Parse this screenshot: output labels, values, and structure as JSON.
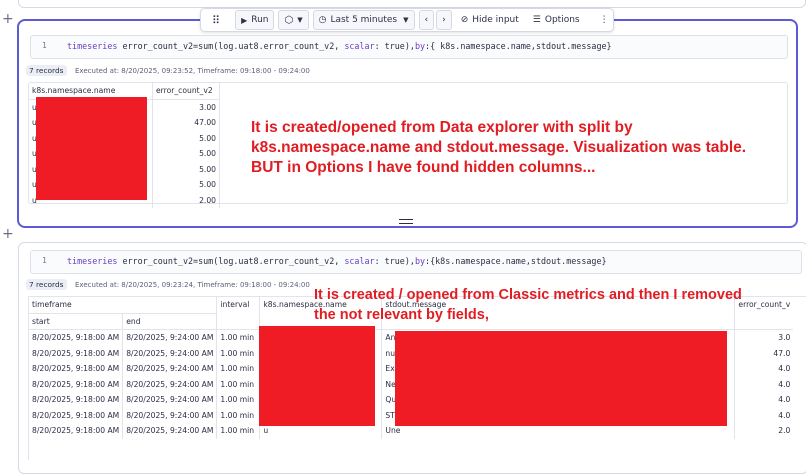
{
  "toolbar": {
    "run_label": "Run",
    "timeframe_label": "Last 5 minutes",
    "hide_input_label": "Hide input",
    "options_label": "Options"
  },
  "section1": {
    "line_number": "1",
    "query_keyword": "timeseries",
    "query_text_a": " error_count_v2=sum(log.uat8.error_count_v2, ",
    "query_param": "scalar",
    "query_text_b": ": true),",
    "query_by": "by",
    "query_text_c": ":{ k8s.namespace.name,stdout.message}",
    "records_label": "7 records",
    "executed_info": "Executed at: 8/20/2025, 09:23:52, Timeframe: 09:18:00 - 09:24:00",
    "columns": [
      "k8s.namespace.name",
      "error_count_v2"
    ],
    "rows": [
      {
        "ns": "u",
        "value": "3.00"
      },
      {
        "ns": "u",
        "value": "47.00"
      },
      {
        "ns": "u",
        "value": "5.00"
      },
      {
        "ns": "u",
        "value": "5.00"
      },
      {
        "ns": "u",
        "value": "5.00"
      },
      {
        "ns": "u",
        "value": "5.00"
      },
      {
        "ns": "u",
        "value": "2.00"
      }
    ],
    "annotation": [
      "It is created/opened from Data explorer with split by",
      "k8s.namespace.name and stdout.message. Visualization was table.",
      "BUT in Options I have found hidden columns..."
    ]
  },
  "section2": {
    "line_number": "1",
    "query_keyword": "timeseries",
    "query_text_a": " error_count_v2=sum(log.uat8.error_count_v2, ",
    "query_param": "scalar",
    "query_text_b": ": true),",
    "query_by": "by",
    "query_text_c": ":{k8s.namespace.name,stdout.message}",
    "records_label": "7 records",
    "executed_info": "Executed at: 8/20/2025, 09:23:24, Timeframe: 09:18:00 - 09:24:00",
    "group_header": "timeframe",
    "columns": [
      "start",
      "end",
      "interval",
      "k8s.namespace.name",
      "stdout.message",
      "error_count_v"
    ],
    "rows": [
      {
        "start": "8/20/2025, 9:18:00 AM",
        "end": "8/20/2025, 9:24:00 AM",
        "interval": "1.00 min",
        "ns": "u",
        "msg": "An",
        "value": "3.0"
      },
      {
        "start": "8/20/2025, 9:18:00 AM",
        "end": "8/20/2025, 9:24:00 AM",
        "interval": "1.00 min",
        "ns": "u",
        "msg": "null",
        "value": "47.0"
      },
      {
        "start": "8/20/2025, 9:18:00 AM",
        "end": "8/20/2025, 9:24:00 AM",
        "interval": "1.00 min",
        "ns": "u",
        "msg": "Exe",
        "value": "4.0"
      },
      {
        "start": "8/20/2025, 9:18:00 AM",
        "end": "8/20/2025, 9:24:00 AM",
        "interval": "1.00 min",
        "ns": "u",
        "msg": "Nex",
        "value": "4.0"
      },
      {
        "start": "8/20/2025, 9:18:00 AM",
        "end": "8/20/2025, 9:24:00 AM",
        "interval": "1.00 min",
        "ns": "u",
        "msg": "Que",
        "value": "4.0"
      },
      {
        "start": "8/20/2025, 9:18:00 AM",
        "end": "8/20/2025, 9:24:00 AM",
        "interval": "1.00 min",
        "ns": "u",
        "msg": "STE",
        "value": "4.0"
      },
      {
        "start": "8/20/2025, 9:18:00 AM",
        "end": "8/20/2025, 9:24:00 AM",
        "interval": "1.00 min",
        "ns": "u",
        "msg": "Une",
        "value": "2.0"
      }
    ],
    "annotation": [
      "It is created / opened from Classic metrics and then I removed",
      "the not relevant by fields,"
    ]
  },
  "colors": {
    "accent": "#5b5bd6",
    "keyword": "#6b3fc2",
    "redaction": "#ef1c26",
    "annotation": "#e11d23"
  },
  "icons": [
    "plus-icon",
    "drag-handle-icon",
    "play-icon",
    "cube-icon",
    "chevron-down-icon",
    "clock-icon",
    "chevron-left-icon",
    "chevron-right-icon",
    "eye-off-icon",
    "sliders-icon",
    "more-vertical-icon"
  ]
}
